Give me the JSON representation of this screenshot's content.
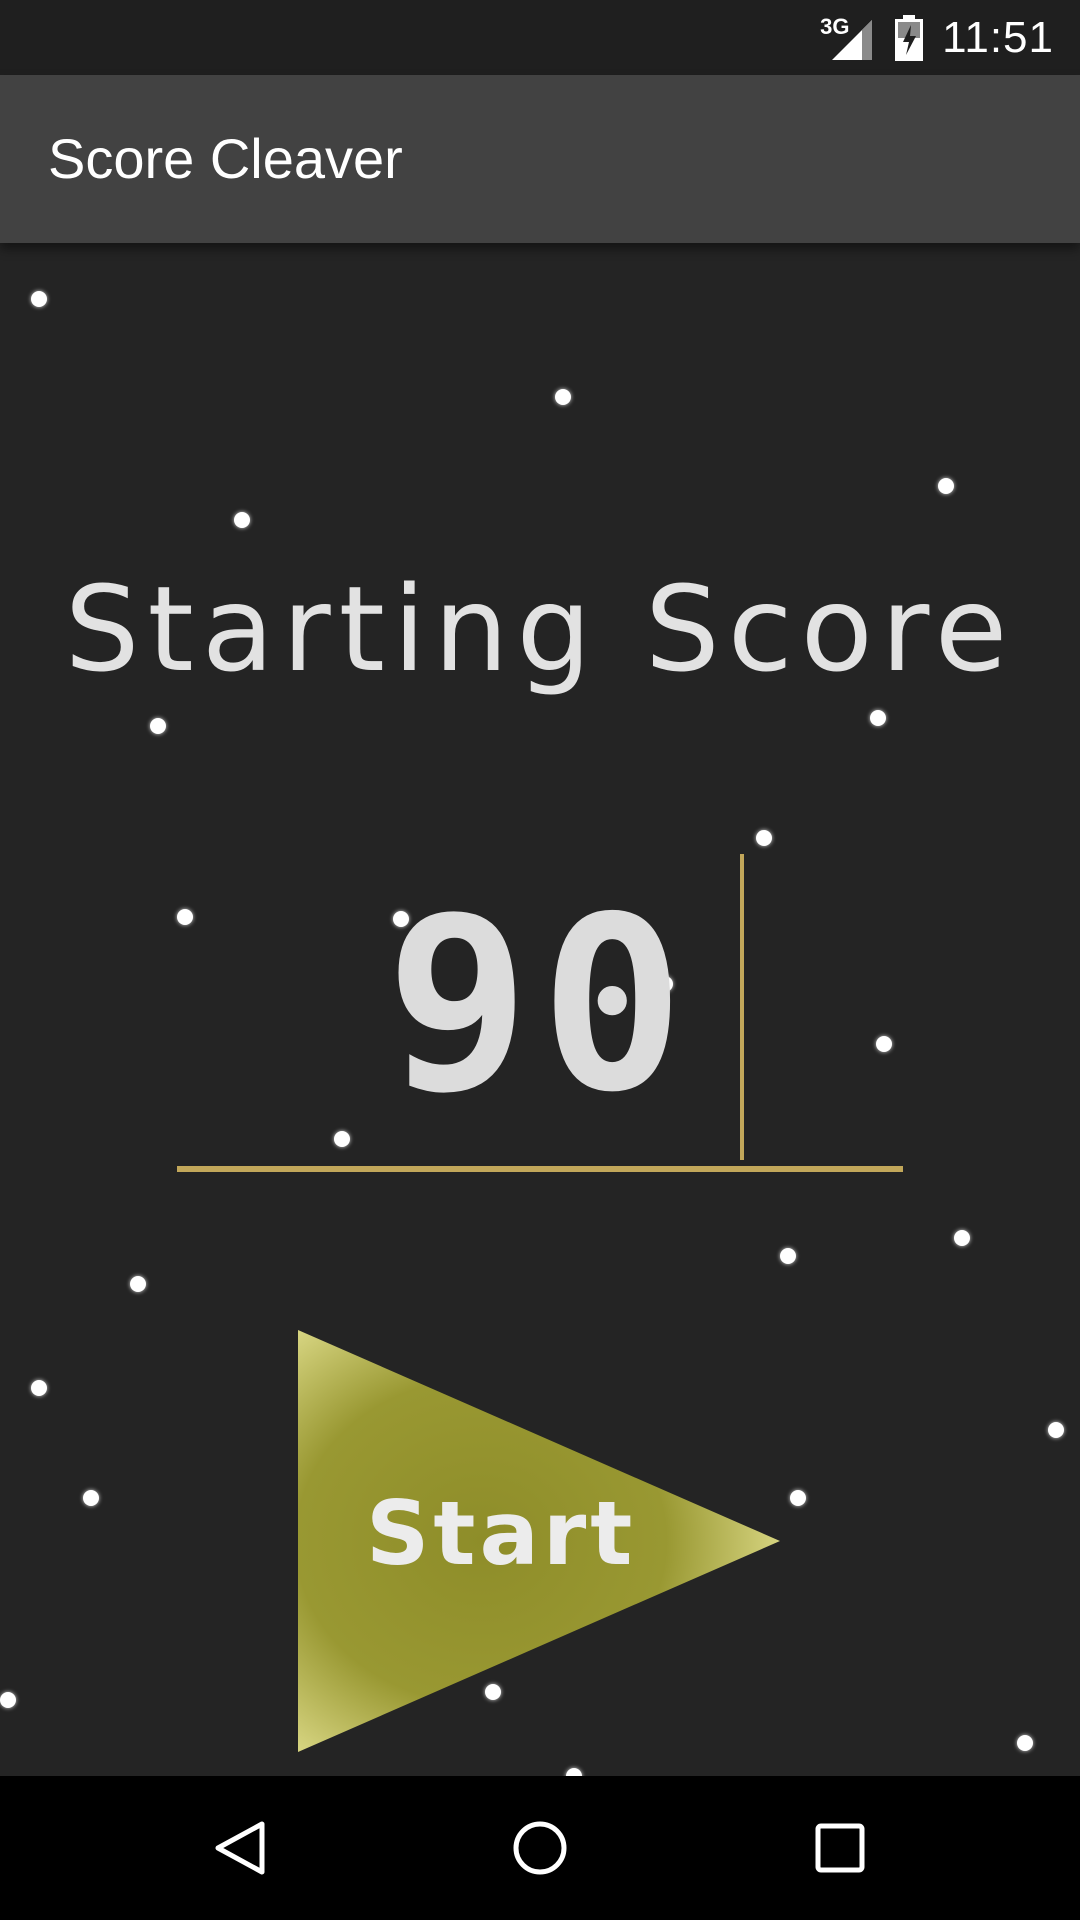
{
  "status_bar": {
    "network": "3G",
    "time": "11:51",
    "icons": [
      "signal-icon",
      "battery-icon"
    ]
  },
  "app_bar": {
    "title": "Score Cleaver"
  },
  "main": {
    "heading": "Starting Score",
    "score_input": {
      "value": "90"
    },
    "start_button": {
      "label": "Start"
    }
  },
  "nav_bar": {
    "buttons": [
      "back-icon",
      "home-icon",
      "recents-icon"
    ]
  },
  "colors": {
    "background": "#242424",
    "app_bar": "#424242",
    "accent": "#c2a75a",
    "start_fill": "#95942e"
  }
}
